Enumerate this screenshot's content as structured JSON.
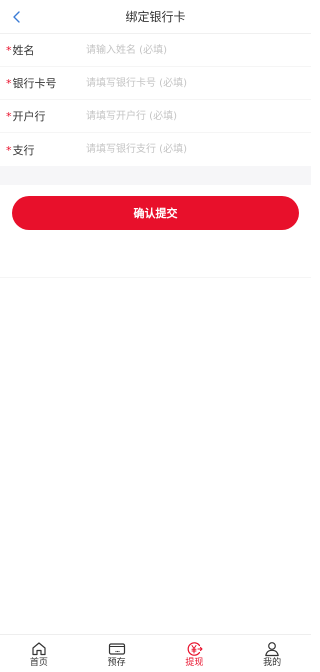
{
  "header": {
    "title": "绑定银行卡",
    "back_icon": "chevron-left-icon"
  },
  "form": {
    "required_mark": "*",
    "fields": [
      {
        "label": "姓名",
        "placeholder": "请输入姓名 (必填)",
        "value": ""
      },
      {
        "label": "银行卡号",
        "placeholder": "请填写银行卡号 (必填)",
        "value": ""
      },
      {
        "label": "开户行",
        "placeholder": "请填写开户行 (必填)",
        "value": ""
      },
      {
        "label": "支行",
        "placeholder": "请填写银行支行 (必填)",
        "value": ""
      }
    ]
  },
  "submit": {
    "label": "确认提交"
  },
  "tabbar": {
    "items": [
      {
        "label": "首页",
        "icon": "home-icon",
        "active": false
      },
      {
        "label": "预存",
        "icon": "wallet-card-icon",
        "active": false
      },
      {
        "label": "提现",
        "icon": "yuan-withdraw-icon",
        "active": true
      },
      {
        "label": "我的",
        "icon": "user-icon",
        "active": false
      }
    ]
  },
  "colors": {
    "accent": "#e8102b",
    "text": "#333333",
    "placeholder": "#c4c4c4",
    "back_icon": "#3a7bd5",
    "band": "#f6f6f8"
  }
}
